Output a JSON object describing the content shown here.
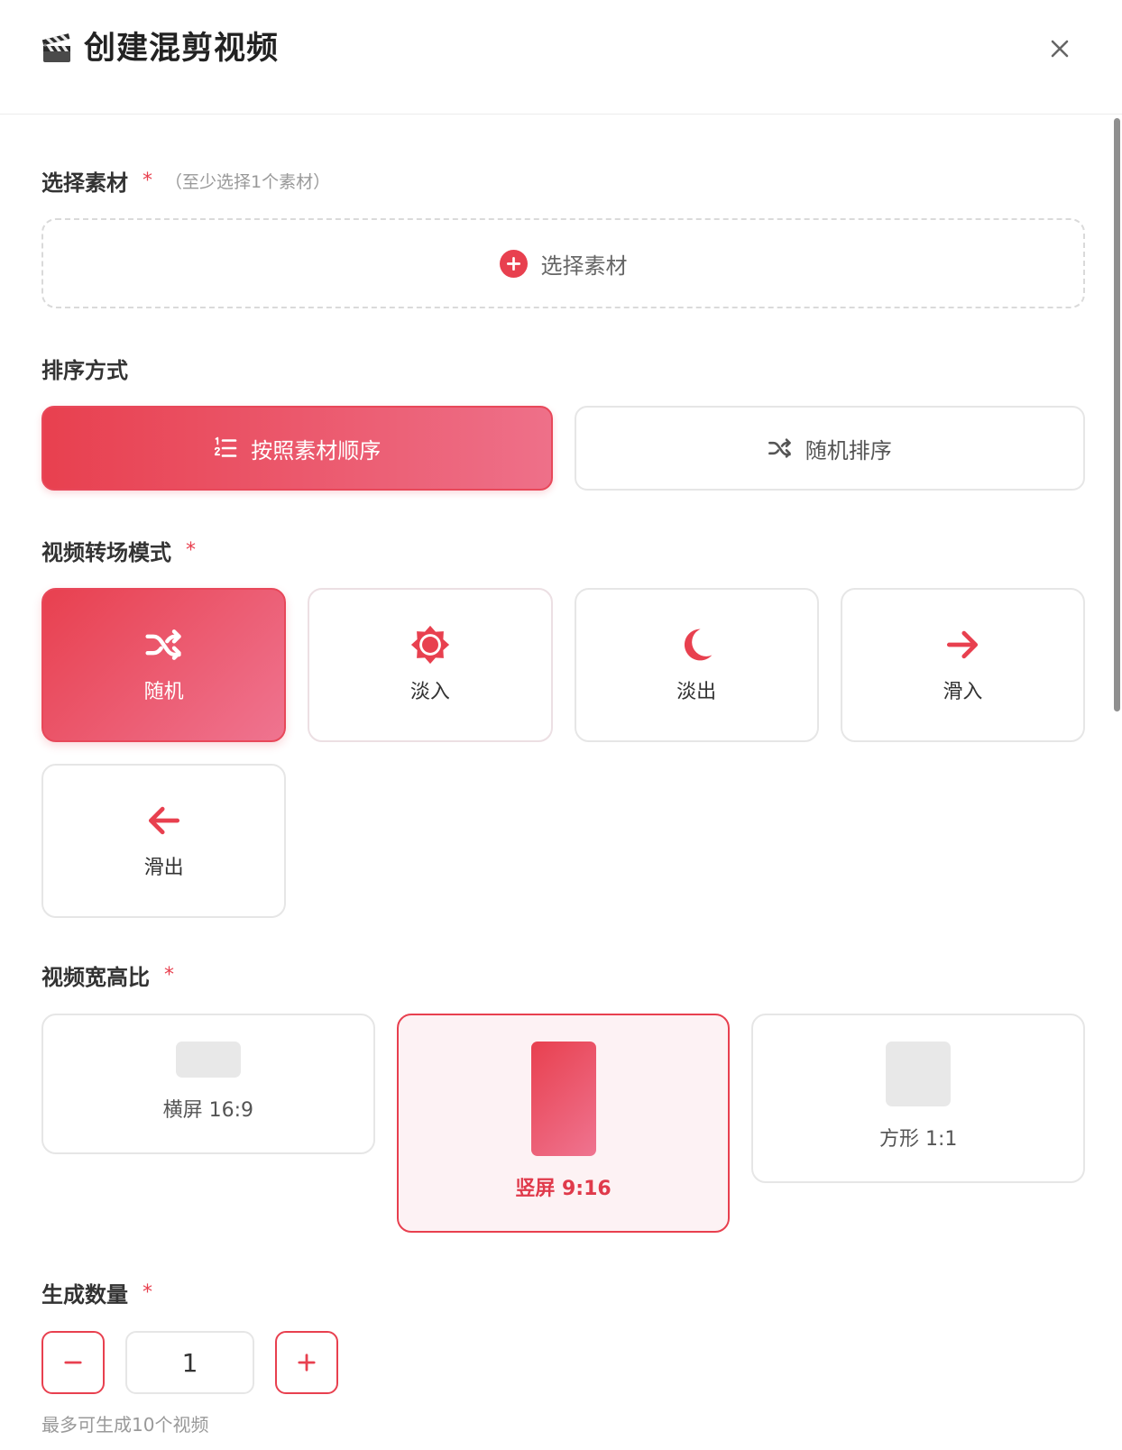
{
  "header": {
    "title": "创建混剪视频",
    "title_icon": "clapper-board-icon",
    "close_icon": "close-icon"
  },
  "materials": {
    "label": "选择素材",
    "required_mark": "*",
    "hint": "（至少选择1个素材）",
    "add_button": {
      "label": "选择素材",
      "icon": "plus-circle-icon"
    }
  },
  "sort": {
    "label": "排序方式",
    "options": [
      {
        "label": "按照素材顺序",
        "icon": "list-ordered-icon",
        "selected": true
      },
      {
        "label": "随机排序",
        "icon": "shuffle-icon",
        "selected": false
      }
    ]
  },
  "transition": {
    "label": "视频转场模式",
    "required_mark": "*",
    "options": [
      {
        "label": "随机",
        "icon": "shuffle-icon",
        "selected": true
      },
      {
        "label": "淡入",
        "icon": "sun-icon",
        "selected": false
      },
      {
        "label": "淡出",
        "icon": "moon-icon",
        "selected": false
      },
      {
        "label": "滑入",
        "icon": "arrow-right-icon",
        "selected": false
      },
      {
        "label": "滑出",
        "icon": "arrow-left-icon",
        "selected": false
      }
    ]
  },
  "aspect_ratio": {
    "label": "视频宽高比",
    "required_mark": "*",
    "options": [
      {
        "label": "横屏 16:9",
        "icon": "landscape-frame-icon",
        "selected": false
      },
      {
        "label": "竖屏 9:16",
        "icon": "portrait-frame-icon",
        "selected": true
      },
      {
        "label": "方形 1:1",
        "icon": "square-frame-icon",
        "selected": false
      }
    ]
  },
  "quantity": {
    "label": "生成数量",
    "required_mark": "*",
    "value": "1",
    "decrement_icon": "minus-icon",
    "increment_icon": "plus-icon",
    "hint": "最多可生成10个视频"
  },
  "colors": {
    "accent": "#e8404f",
    "accent_light": "#ef708c",
    "selected_bg": "#fdf2f4",
    "border": "#e6e6e6",
    "text": "#333333",
    "muted": "#999999"
  }
}
